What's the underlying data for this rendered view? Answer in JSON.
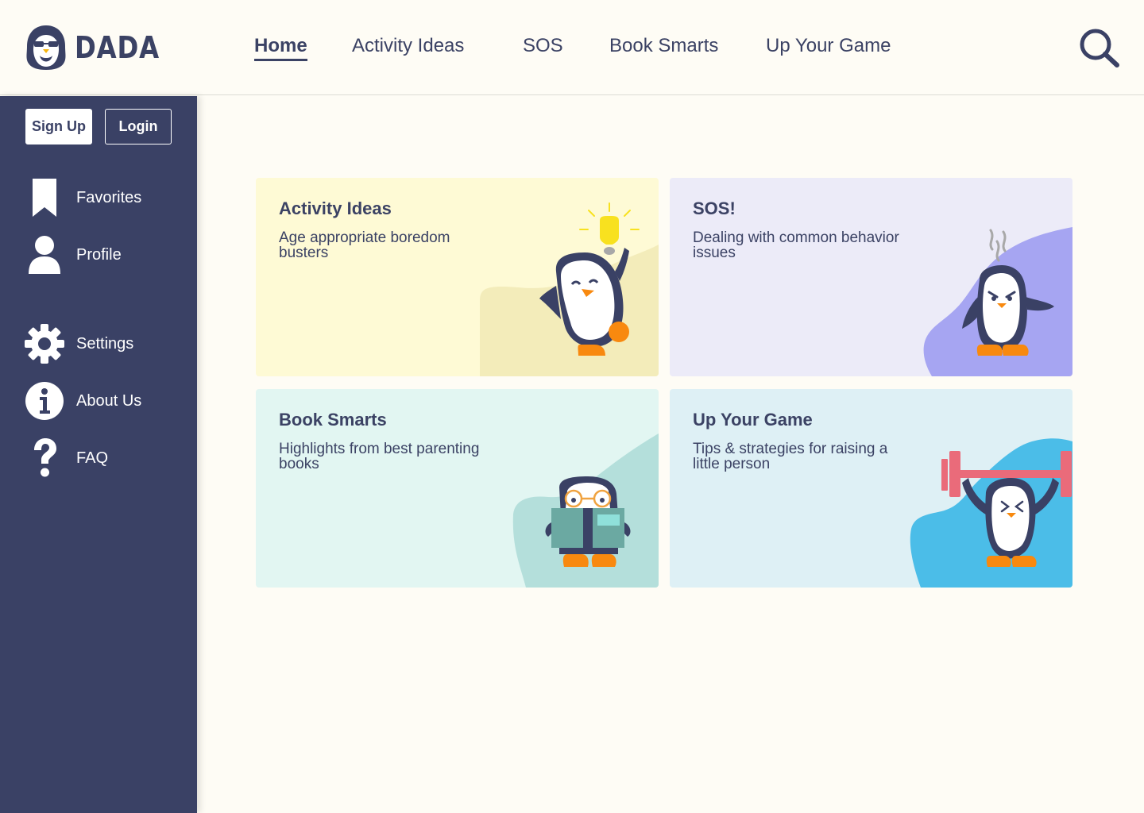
{
  "brand": {
    "name": "DADA"
  },
  "nav": {
    "items": [
      {
        "label": "Home",
        "active": true
      },
      {
        "label": "Activity Ideas",
        "active": false
      },
      {
        "label": "SOS",
        "active": false
      },
      {
        "label": "Book Smarts",
        "active": false
      },
      {
        "label": "Up Your Game",
        "active": false
      }
    ],
    "search_icon": "search-icon"
  },
  "sidebar": {
    "signup_label": "Sign Up",
    "login_label": "Login",
    "items": [
      {
        "label": "Favorites",
        "icon": "bookmark-icon"
      },
      {
        "label": "Profile",
        "icon": "user-icon"
      },
      {
        "label": "Settings",
        "icon": "gear-icon"
      },
      {
        "label": "About Us",
        "icon": "info-icon"
      },
      {
        "label": "FAQ",
        "icon": "question-icon"
      }
    ]
  },
  "cards": [
    {
      "title": "Activity Ideas",
      "description": "Age appropriate boredom busters",
      "color": "#fefad5",
      "illustration": "penguin-lightbulb-icon"
    },
    {
      "title": "SOS!",
      "description": "Dealing with common behavior issues",
      "color": "#ecebf8",
      "illustration": "penguin-angry-icon"
    },
    {
      "title": "Book Smarts",
      "description": "Highlights from best parenting books",
      "color": "#e2f6f2",
      "illustration": "penguin-reading-icon"
    },
    {
      "title": "Up Your Game",
      "description": "Tips & strategies for raising a little person",
      "color": "#def0f5",
      "illustration": "penguin-lifting-icon"
    }
  ],
  "colors": {
    "primary": "#3a4165",
    "background": "#fefcf5",
    "penguin_orange": "#f8890f"
  }
}
